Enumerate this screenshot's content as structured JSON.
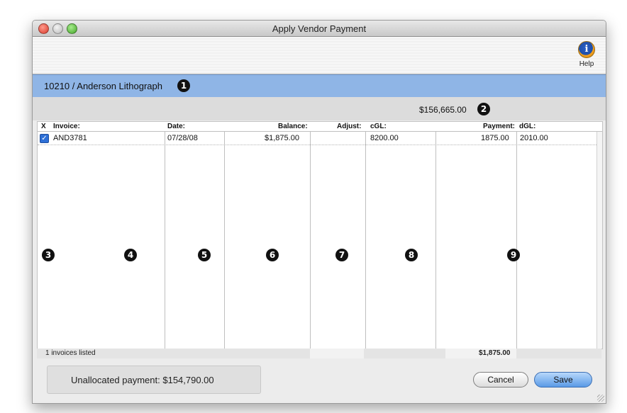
{
  "window": {
    "title": "Apply Vendor Payment"
  },
  "toolbar": {
    "help_label": "Help",
    "help_glyph": "i"
  },
  "vendor": {
    "name": "10210 / Anderson Lithograph"
  },
  "payment": {
    "total": "$156,665.00"
  },
  "callouts": [
    "1",
    "2",
    "3",
    "4",
    "5",
    "6",
    "7",
    "8",
    "9"
  ],
  "table": {
    "headers": {
      "x": "X",
      "invoice": "Invoice:",
      "date": "Date:",
      "balance": "Balance:",
      "adjust": "Adjust:",
      "cgl": "cGL:",
      "payment": "Payment:",
      "dgl": "dGL:"
    },
    "rows": [
      {
        "checked": true,
        "invoice": "AND3781",
        "date": "07/28/08",
        "balance": "$1,875.00",
        "adjust": "",
        "cgl": "8200.00",
        "payment": "1875.00",
        "dgl": "2010.00"
      }
    ]
  },
  "footer": {
    "count_text": "1 invoices listed",
    "payment_total": "$1,875.00"
  },
  "unallocated": {
    "text": "Unallocated payment:  $154,790.00"
  },
  "buttons": {
    "cancel": "Cancel",
    "save": "Save"
  },
  "colors": {
    "vendor_bar": "#8fb5e6",
    "total_bar": "#dcdcdc",
    "checkbox": "#2d6fd6",
    "save_button": "#5a9ae6"
  }
}
